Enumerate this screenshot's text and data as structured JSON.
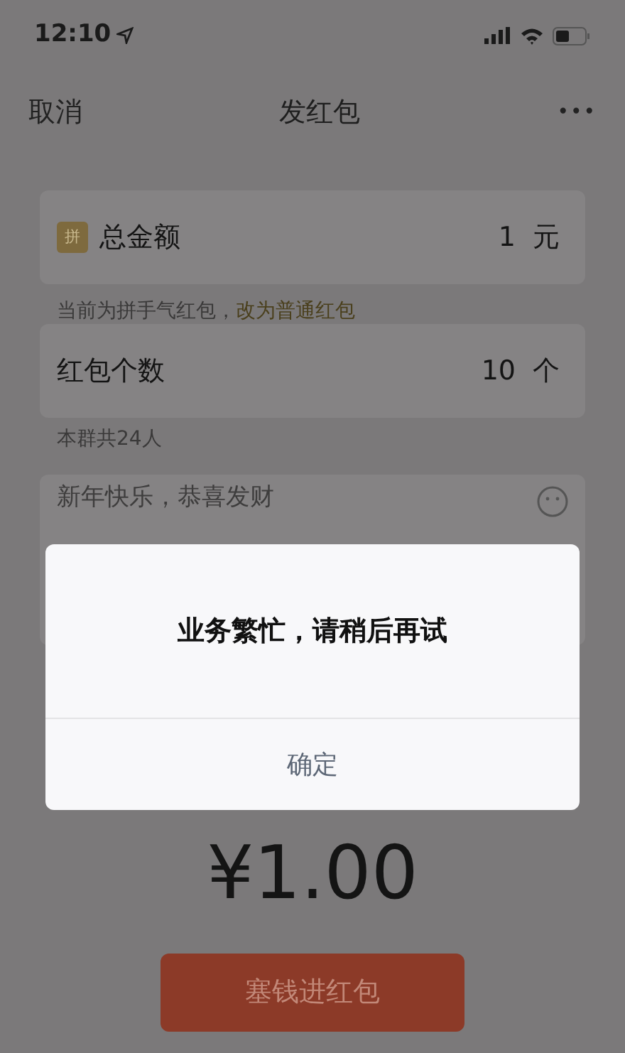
{
  "status_bar": {
    "time": "12:10"
  },
  "nav": {
    "cancel": "取消",
    "title": "发红包",
    "more": "•••"
  },
  "amount_row": {
    "badge": "拼",
    "label": "总金额",
    "value": "1",
    "unit": "元"
  },
  "amount_hint": {
    "text": "当前为拼手气红包，",
    "link": "改为普通红包"
  },
  "count_row": {
    "label": "红包个数",
    "value": "10",
    "unit": "个"
  },
  "count_hint": "本群共24人",
  "greeting": {
    "placeholder": "新年快乐，恭喜发财"
  },
  "total": "¥1.00",
  "submit_button": {
    "label": "塞钱进红包",
    "disabled": true
  },
  "dialog": {
    "message": "业务繁忙，请稍后再试",
    "button": "确定"
  }
}
